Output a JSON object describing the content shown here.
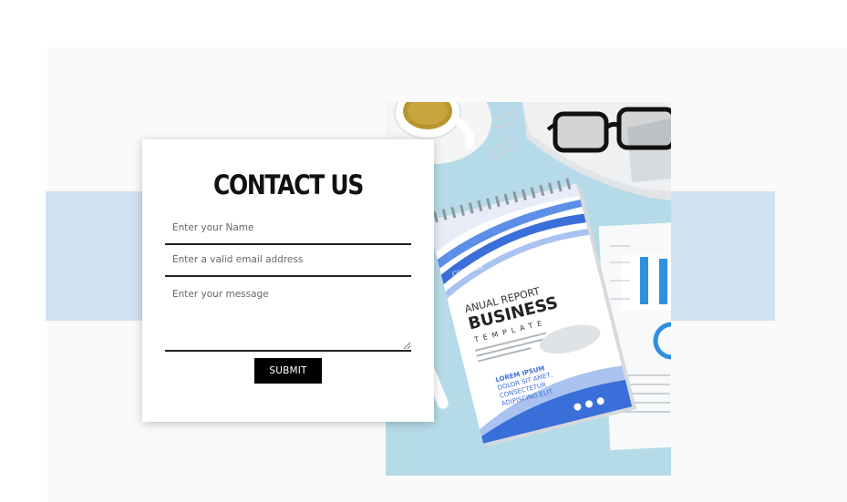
{
  "form": {
    "title": "CONTACT US",
    "name_placeholder": "Enter your Name",
    "email_placeholder": "Enter a valid email address",
    "message_placeholder": "Enter your message",
    "submit_label": "SUBMIT"
  },
  "image": {
    "notebook_company": "COMPANY",
    "notebook_line1": "ANUAL REPORT",
    "notebook_line2": "BUSINESS",
    "notebook_line3": "TEMPLATE",
    "notebook_lorem1": "LOREM IPSUM",
    "notebook_lorem2": "DOLOR SIT AMET,",
    "notebook_lorem3": "CONSECTETUR",
    "notebook_lorem4": "ADIPISCING ELIT."
  },
  "colors": {
    "band": "#d0e2f2",
    "photo_bg": "#b5dbe8",
    "button_bg": "#000000",
    "accent_blue": "#3a78c8"
  }
}
